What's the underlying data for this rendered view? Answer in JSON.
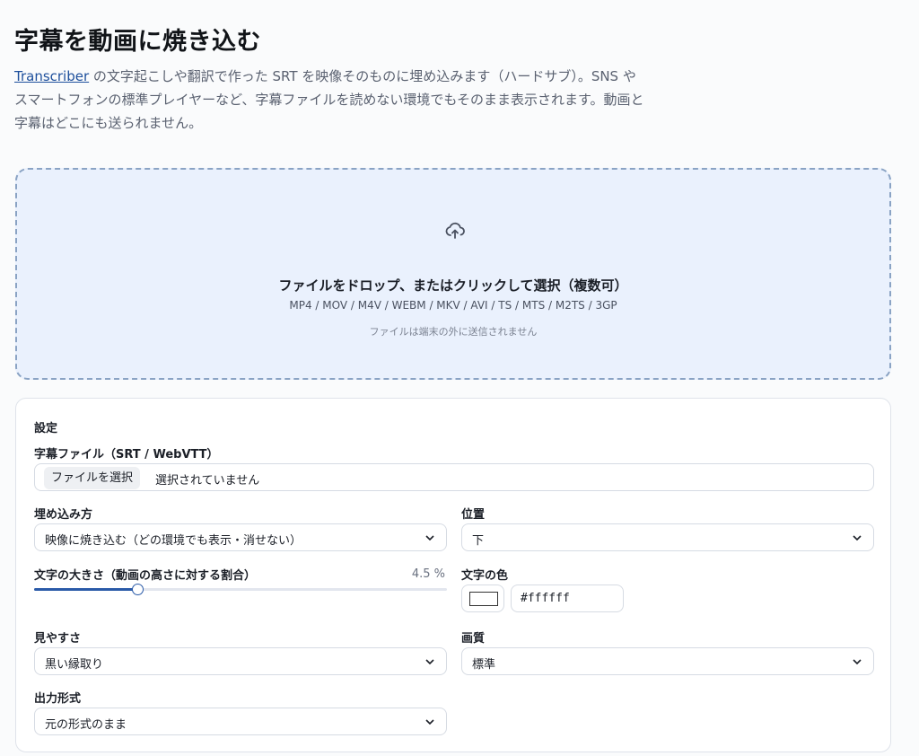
{
  "page": {
    "title": "字幕を動画に焼き込む",
    "intro": {
      "link": "Transcriber",
      "line1": " の文字起こしや翻訳で作った SRT を映像そのものに埋め込みます（ハードサブ）。SNS や",
      "line2": "スマートフォンの標準プレイヤーなど、字幕ファイルを読めない環境でもそのまま表示されます。動画と",
      "line3": "字幕はどこにも送られません。"
    }
  },
  "dropzone": {
    "icon": "cloud-upload-icon",
    "title": "ファイルをドロップ、またはクリックして選択（複数可）",
    "formats": "MP4 / MOV / M4V / WEBM / MKV / AVI / TS / MTS / M2TS / 3GP",
    "note": "ファイルは端末の外に送信されません"
  },
  "settings": {
    "heading": "設定",
    "subtitle_file": {
      "label": "字幕ファイル（SRT / WebVTT）",
      "button": "ファイルを選択",
      "status": "選択されていません"
    },
    "embed_method": {
      "label": "埋め込み方",
      "value": "映像に焼き込む（どの環境でも表示・消せない）"
    },
    "position": {
      "label": "位置",
      "value": "下"
    },
    "font_size": {
      "label": "文字の大きさ（動画の高さに対する割合）",
      "value_text": "4.5 %",
      "fraction": 0.25
    },
    "text_color": {
      "label": "文字の色",
      "hex": "#ffffff"
    },
    "visibility": {
      "label": "見やすさ",
      "value": "黒い縁取り"
    },
    "quality": {
      "label": "画質",
      "value": "標準"
    },
    "output_format": {
      "label": "出力形式",
      "value": "元の形式のまま"
    }
  },
  "colors": {
    "accent": "#2a5aa8",
    "link": "#1d4f9c",
    "dropzone_bg": "#eaf1fd",
    "dropzone_border": "#8aa3c4"
  }
}
